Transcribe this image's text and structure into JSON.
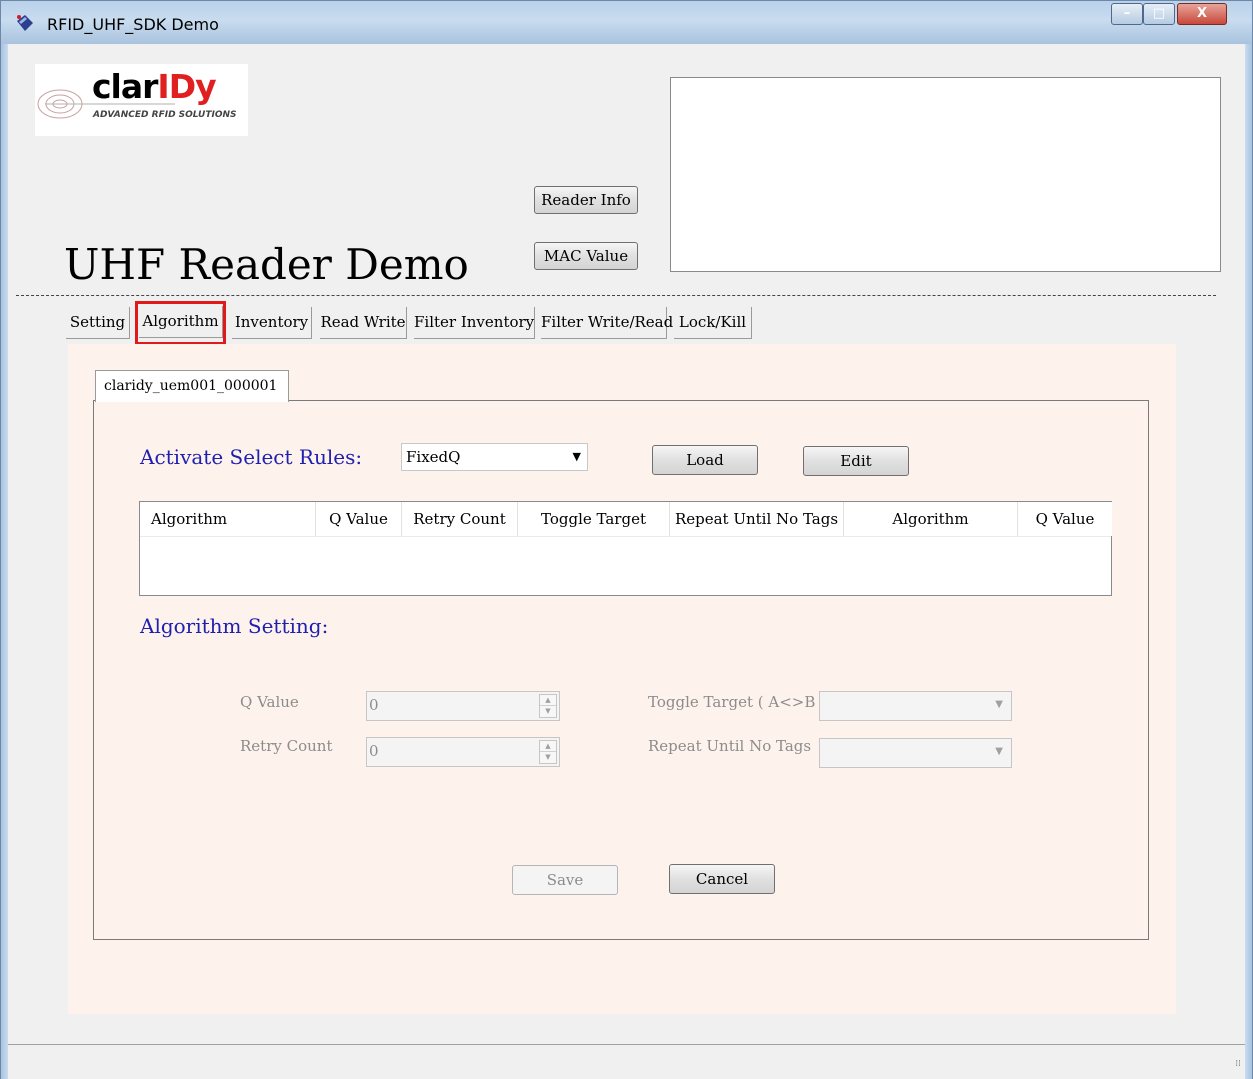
{
  "window": {
    "title": "RFID_UHF_SDK Demo",
    "controls": {
      "minimize": "–",
      "maximize": "□",
      "close": "X"
    }
  },
  "logo": {
    "brand_prefix": "clar",
    "brand_accent": "IDy",
    "tagline": "ADVANCED RFID SOLUTIONS",
    "accent_color": "#e02020"
  },
  "header": {
    "app_title": "UHF Reader Demo",
    "reader_info_button": "Reader Info",
    "mac_value_button": "MAC Value",
    "info_text": ""
  },
  "tabs": [
    {
      "label": "Setting"
    },
    {
      "label": "Algorithm",
      "selected": true
    },
    {
      "label": "Inventory"
    },
    {
      "label": "Read Write"
    },
    {
      "label": "Filter Inventory"
    },
    {
      "label": "Filter Write/Read"
    },
    {
      "label": "Lock/Kill"
    }
  ],
  "reader_tab": {
    "label": "claridy_uem001_000001"
  },
  "select_rules": {
    "label": "Activate Select Rules:",
    "selected": "FixedQ",
    "load_button": "Load",
    "edit_button": "Edit"
  },
  "rules_table": {
    "columns": [
      "Algorithm",
      "Q Value",
      "Retry Count",
      "Toggle Target",
      "Repeat Until No Tags",
      "Algorithm",
      "Q Value"
    ],
    "rows": []
  },
  "algorithm_setting": {
    "label": "Algorithm Setting:",
    "q_value_label": "Q Value",
    "q_value": "0",
    "retry_count_label": "Retry Count",
    "retry_count": "0",
    "toggle_target_label": "Toggle Target ( A<>B )",
    "toggle_target_value": "",
    "repeat_until_no_tags_label": "Repeat Until No Tags",
    "repeat_until_no_tags_value": "",
    "save_button": "Save",
    "cancel_button": "Cancel"
  },
  "colors": {
    "section_label": "#1f1fb0",
    "panel_bg": "#fdf3ec",
    "highlight": "#e0191b"
  }
}
